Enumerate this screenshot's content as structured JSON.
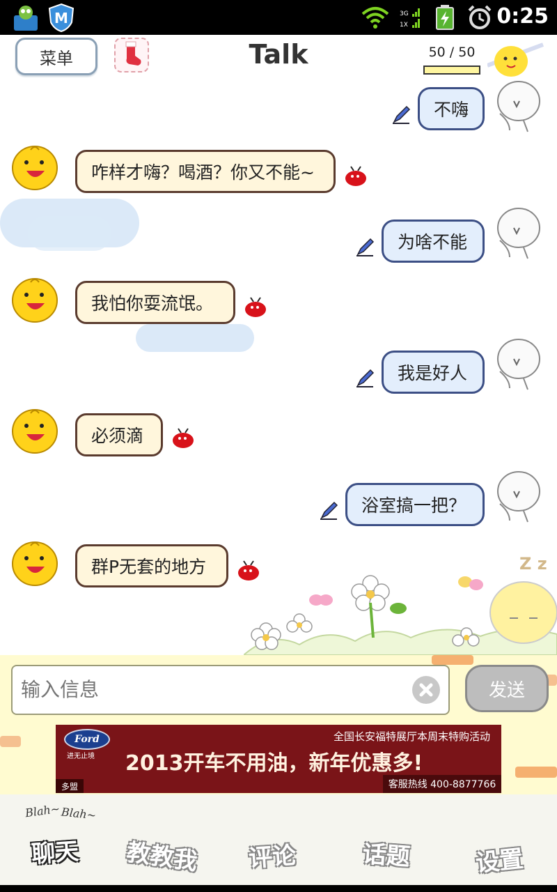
{
  "status_bar": {
    "time": "0:25",
    "network_label_top": "3G",
    "network_label_bottom": "1X"
  },
  "header": {
    "menu_label": "菜单",
    "title": "Talk",
    "counter": "50 / 50",
    "energy_fraction": 1.0
  },
  "messages": [
    {
      "side": "right",
      "text": "不嗨"
    },
    {
      "side": "left",
      "text": "咋样才嗨？喝酒？你又不能~"
    },
    {
      "side": "right",
      "text": "为啥不能"
    },
    {
      "side": "left",
      "text": "我怕你耍流氓。"
    },
    {
      "side": "right",
      "text": "我是好人"
    },
    {
      "side": "left",
      "text": "必须滴"
    },
    {
      "side": "right",
      "text": "浴室搞一把？"
    },
    {
      "side": "left",
      "text": "群P无套的地方"
    }
  ],
  "decor": {
    "sleep_text": "Z z"
  },
  "input_bar": {
    "placeholder": "输入信息",
    "send_label": "发送"
  },
  "ad": {
    "brand": "Ford",
    "slogan": "进无止境",
    "top_line": "全国长安福特展厅本周末特购活动",
    "headline": "2013开车不用油，新年优惠多!",
    "hotline": "客服热线 400-8877766",
    "source": "多盟"
  },
  "nav": {
    "blah_1": "Blah~",
    "blah_2": "Blah~",
    "items": [
      {
        "label": "聊天"
      },
      {
        "label": "教教我"
      },
      {
        "label": "评论"
      },
      {
        "label": "话题"
      },
      {
        "label": "设置"
      }
    ]
  },
  "colors": {
    "left_bubble_border": "#5a3b2e",
    "right_bubble_border": "#3c4f85",
    "ad_background": "#7a1418"
  }
}
